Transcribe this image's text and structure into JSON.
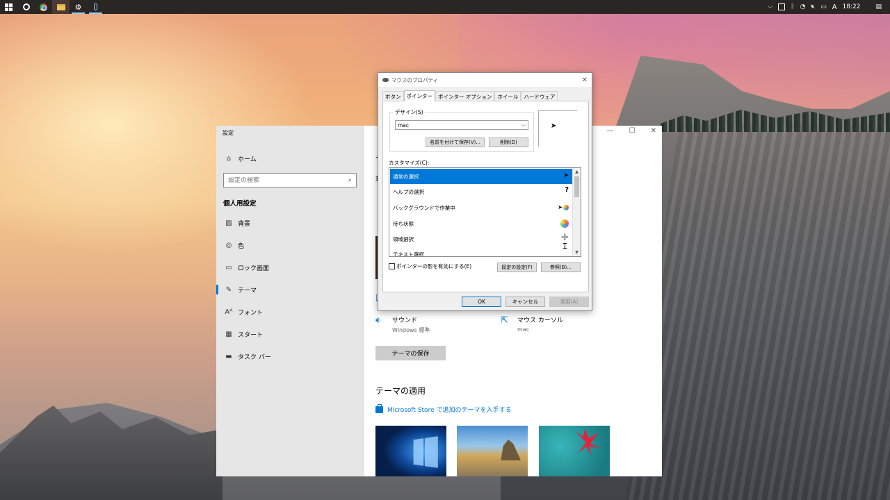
{
  "taskbar": {
    "tray": {
      "chevron": "⌵",
      "ime": "A",
      "clock": "18:22"
    }
  },
  "settings": {
    "window_title": "設定",
    "home_label": "ホーム",
    "search_placeholder": "設定の検索",
    "section_heading": "個人用設定",
    "nav": [
      {
        "label": "背景",
        "icon": "image-icon"
      },
      {
        "label": "色",
        "icon": "palette-icon"
      },
      {
        "label": "ロック画面",
        "icon": "lock-screen-icon"
      },
      {
        "label": "テーマ",
        "icon": "theme-icon"
      },
      {
        "label": "フォント",
        "icon": "font-icon"
      },
      {
        "label": "スタート",
        "icon": "start-icon"
      },
      {
        "label": "タスク バー",
        "icon": "taskbar-icon"
      }
    ],
    "selected_nav": "テーマ",
    "main": {
      "sound_title": "サウンド",
      "sound_value": "Windows 標準",
      "cursor_title": "マウス カーソル",
      "cursor_value": "mac",
      "save_theme_button": "テーマの保存",
      "apply_heading": "テーマの適用",
      "store_link": "Microsoft Store で追加のテーマを入手する"
    }
  },
  "dialog": {
    "title": "マウスのプロパティ",
    "tabs": [
      "ボタン",
      "ポインター",
      "ポインター オプション",
      "ホイール",
      "ハードウェア"
    ],
    "active_tab": "ポインター",
    "design_label": "デザイン(S)",
    "design_value": "mac",
    "save_as_button": "名前を付けて保存(V)...",
    "delete_button": "削除(D)",
    "customize_label": "カスタマイズ(C):",
    "pointer_list": [
      {
        "label": "通常の選択",
        "selected": true
      },
      {
        "label": "ヘルプの選択",
        "selected": false
      },
      {
        "label": "バックグラウンドで作業中",
        "selected": false
      },
      {
        "label": "待ち状態",
        "selected": false
      },
      {
        "label": "領域選択",
        "selected": false
      },
      {
        "label": "テキスト選択",
        "selected": false
      }
    ],
    "shadow_checkbox_label": "ポインターの影を有効にする(E)",
    "shadow_checked": false,
    "default_button": "既定の設定(F)",
    "browse_button": "参照(B)...",
    "ok_button": "OK",
    "cancel_button": "キャンセル",
    "apply_button": "適用(A)"
  }
}
